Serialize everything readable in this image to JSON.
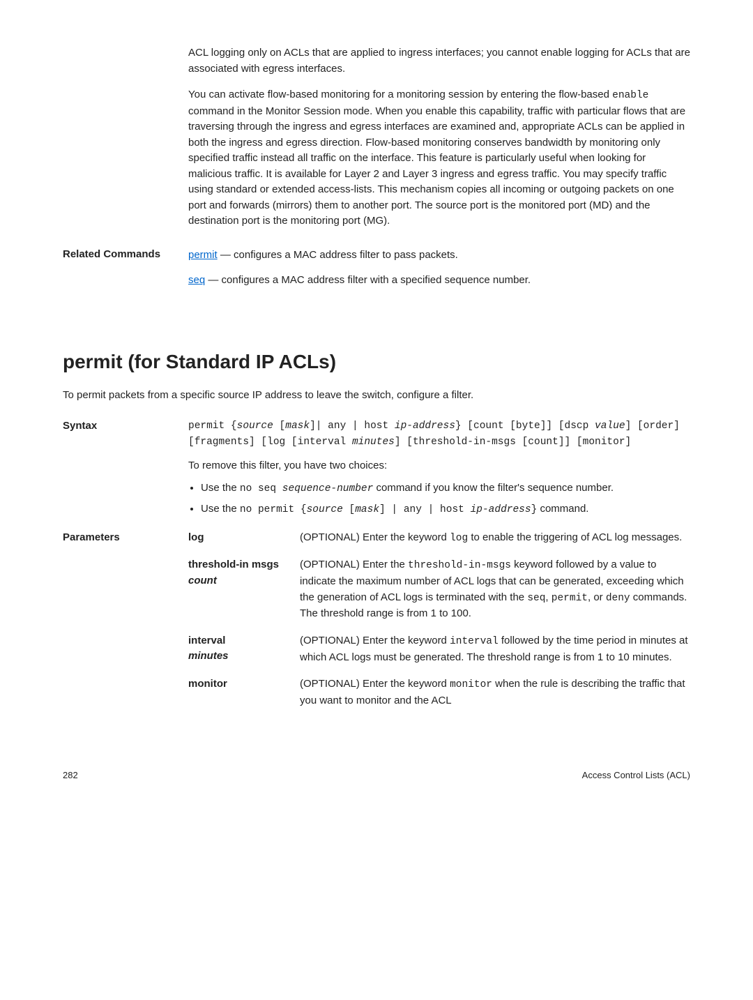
{
  "top": {
    "para1": "ACL logging only on ACLs that are applied to ingress interfaces; you cannot enable logging for ACLs that are associated with egress interfaces.",
    "para2_a": "You can activate flow-based monitoring for a monitoring session by entering the flow-based ",
    "para2_code": "enable",
    "para2_b": " command in the Monitor Session mode. When you enable this capability, traffic with particular flows that are traversing through the ingress and egress interfaces are examined and, appropriate ACLs can be applied in both the ingress and egress direction. Flow-based monitoring conserves bandwidth by monitoring only specified traffic instead all traffic on the interface. This feature is particularly useful when looking for malicious traffic. It is available for Layer 2 and Layer 3 ingress and egress traffic. You may specify traffic using standard or extended access-lists. This mechanism copies all incoming or outgoing packets on one port and forwards (mirrors) them to another port. The source port is the monitored port (MD) and the destination port is the monitoring port (MG)."
  },
  "related": {
    "label": "Related Commands",
    "permit_link": "permit",
    "permit_text": " — configures a MAC address filter to pass packets.",
    "seq_link": "seq",
    "seq_text": " — configures a MAC address filter with a specified sequence number."
  },
  "heading": "permit (for Standard IP ACLs)",
  "subhead": "To permit packets from a specific source IP address to leave the switch, configure a filter.",
  "syntax": {
    "label": "Syntax",
    "code_parts": {
      "p1": "permit {",
      "p2": "source",
      "p3": " [",
      "p4": "mask",
      "p5": "]| any | host ",
      "p6": "ip-address",
      "p7": "} [count [byte]] [dscp ",
      "p8": "value",
      "p9": "] [order] [fragments] [log [interval ",
      "p10": "minutes",
      "p11": "] [threshold-in-msgs [count]] [monitor]"
    },
    "intro": "To remove this filter, you have two choices:",
    "bullet1_a": "Use the ",
    "bullet1_code1": "no seq ",
    "bullet1_code2": "sequence-number",
    "bullet1_b": " command if you know the filter's sequence number.",
    "bullet2_a": "Use the ",
    "bullet2_code1": "no permit {",
    "bullet2_code2": "source",
    "bullet2_code3": " [",
    "bullet2_code4": "mask",
    "bullet2_code5": "] | any | host ",
    "bullet2_code6": "ip-address",
    "bullet2_code7": "}",
    "bullet2_b": " command."
  },
  "params": {
    "label": "Parameters",
    "log": {
      "name": "log",
      "desc_a": "(OPTIONAL) Enter the keyword ",
      "desc_code": "log",
      "desc_b": " to enable the triggering of ACL log messages."
    },
    "threshold": {
      "name1": "threshold-in msgs ",
      "name2": "count",
      "desc_a": "(OPTIONAL) Enter the ",
      "desc_code1": "threshold-in-msgs",
      "desc_b": " keyword followed by a value to indicate the maximum number of ACL logs that can be generated, exceeding which the generation of ACL logs is terminated with the ",
      "desc_code2": "seq",
      "desc_c": ", ",
      "desc_code3": "permit",
      "desc_d": ", or ",
      "desc_code4": "deny",
      "desc_e": " commands. The threshold range is from 1 to 100."
    },
    "interval": {
      "name1": "interval",
      "name2": "minutes",
      "desc_a": "(OPTIONAL) Enter the keyword ",
      "desc_code": "interval",
      "desc_b": " followed by the time period in minutes at which ACL logs must be generated. The threshold range is from 1 to 10 minutes."
    },
    "monitor": {
      "name": "monitor",
      "desc_a": "(OPTIONAL) Enter the keyword ",
      "desc_code": "monitor",
      "desc_b": " when the rule is describing the traffic that you want to monitor and the ACL"
    }
  },
  "footer": {
    "page": "282",
    "title": "Access Control Lists (ACL)"
  }
}
